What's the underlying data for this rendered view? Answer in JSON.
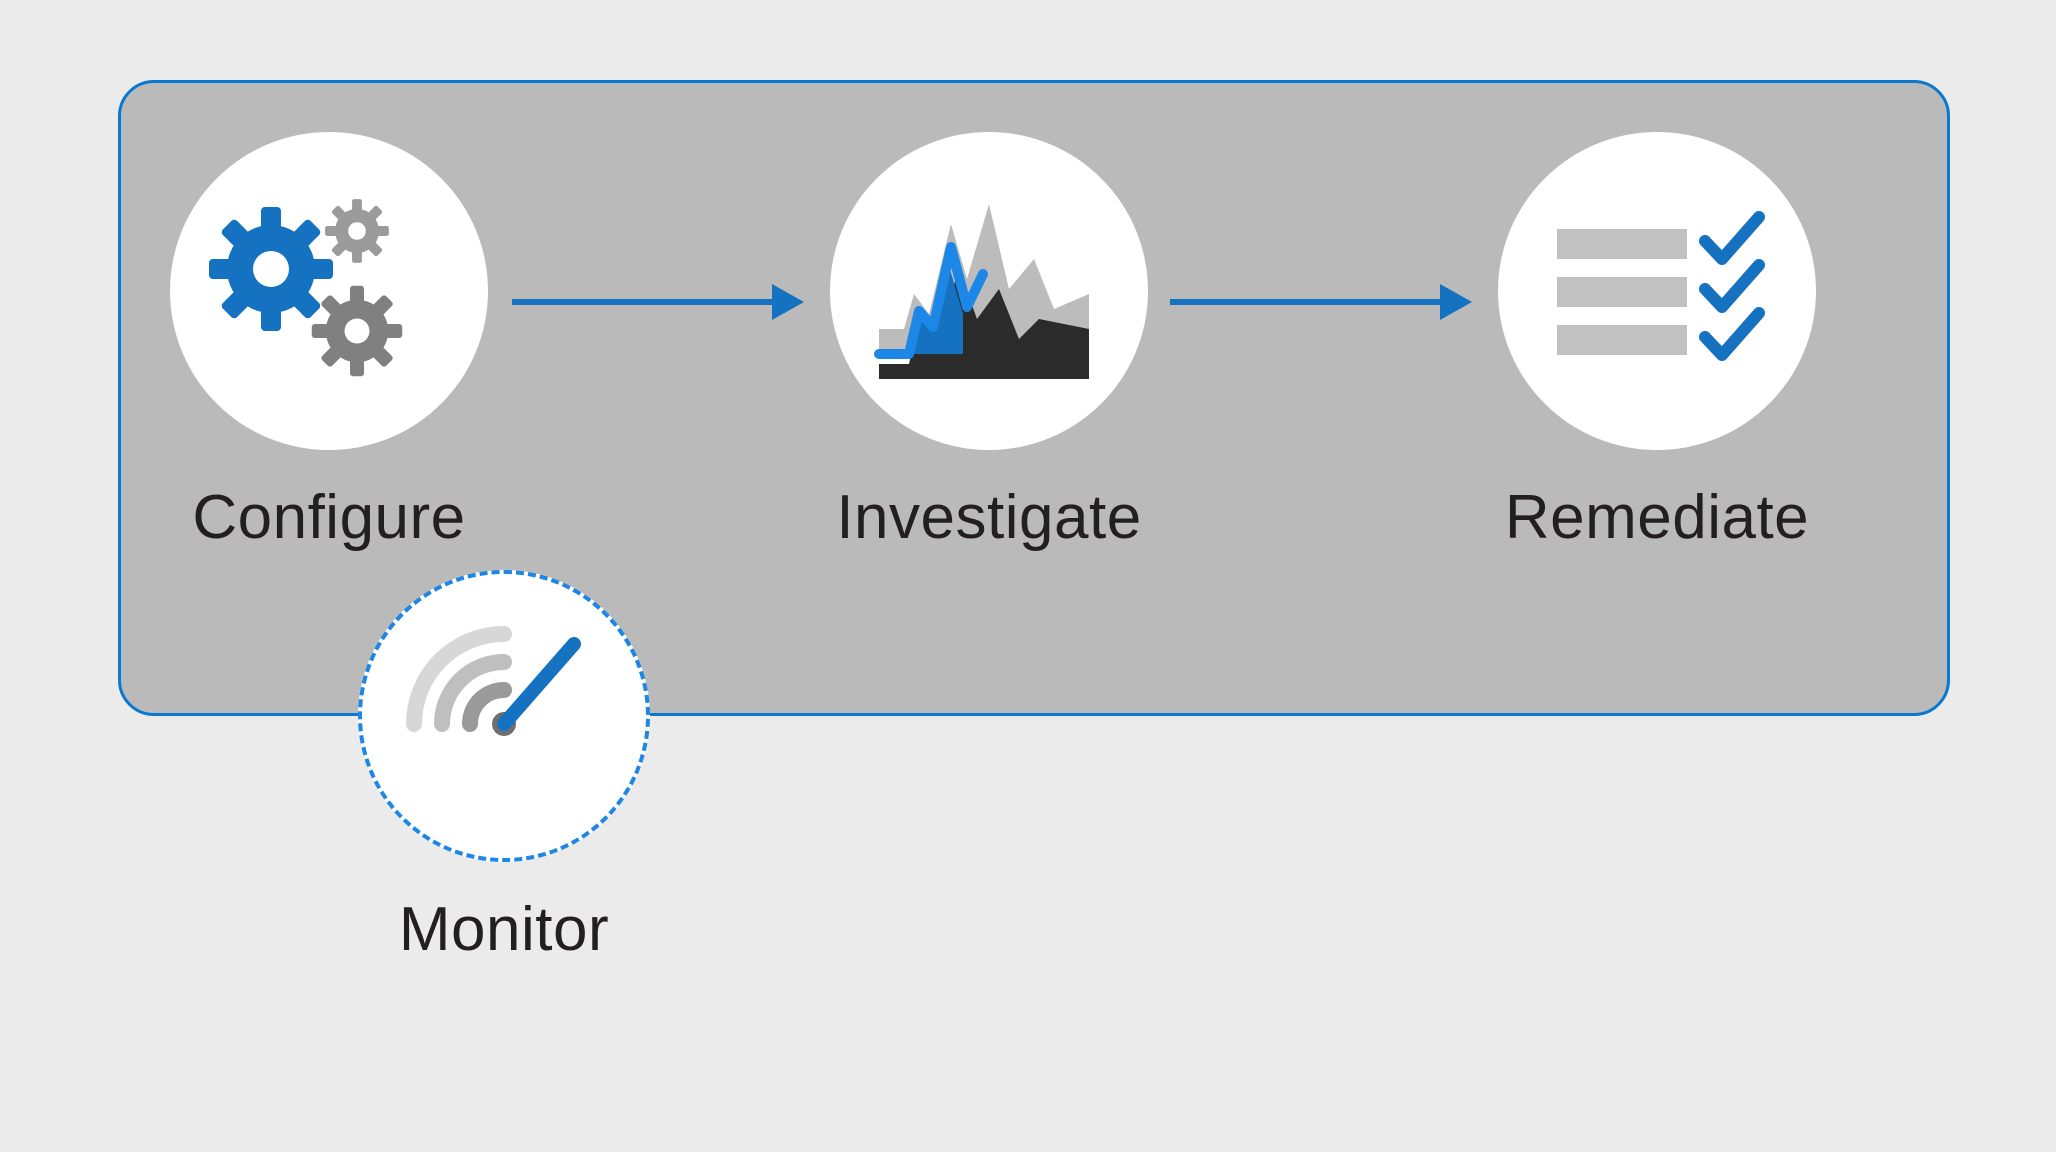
{
  "colors": {
    "page_bg": "#ebebeb",
    "box_bg": "#bababa",
    "box_border": "#0b78d0",
    "circle_bg": "#ffffff",
    "accent_blue": "#1572c0",
    "blue_bright": "#1c87e6",
    "gray_mid": "#9b9b9b",
    "gray_light": "#c1c1c1",
    "gray_dark": "#333333",
    "text": "#231f20"
  },
  "steps": [
    {
      "id": "configure",
      "label": "Configure",
      "icon": "gears-icon"
    },
    {
      "id": "investigate",
      "label": "Investigate",
      "icon": "chart-pulse-icon"
    },
    {
      "id": "remediate",
      "label": "Remediate",
      "icon": "checklist-icon"
    }
  ],
  "monitor": {
    "id": "monitor",
    "label": "Monitor",
    "icon": "radar-target-icon"
  },
  "arrows": [
    {
      "from": "configure",
      "to": "investigate"
    },
    {
      "from": "investigate",
      "to": "remediate"
    }
  ]
}
